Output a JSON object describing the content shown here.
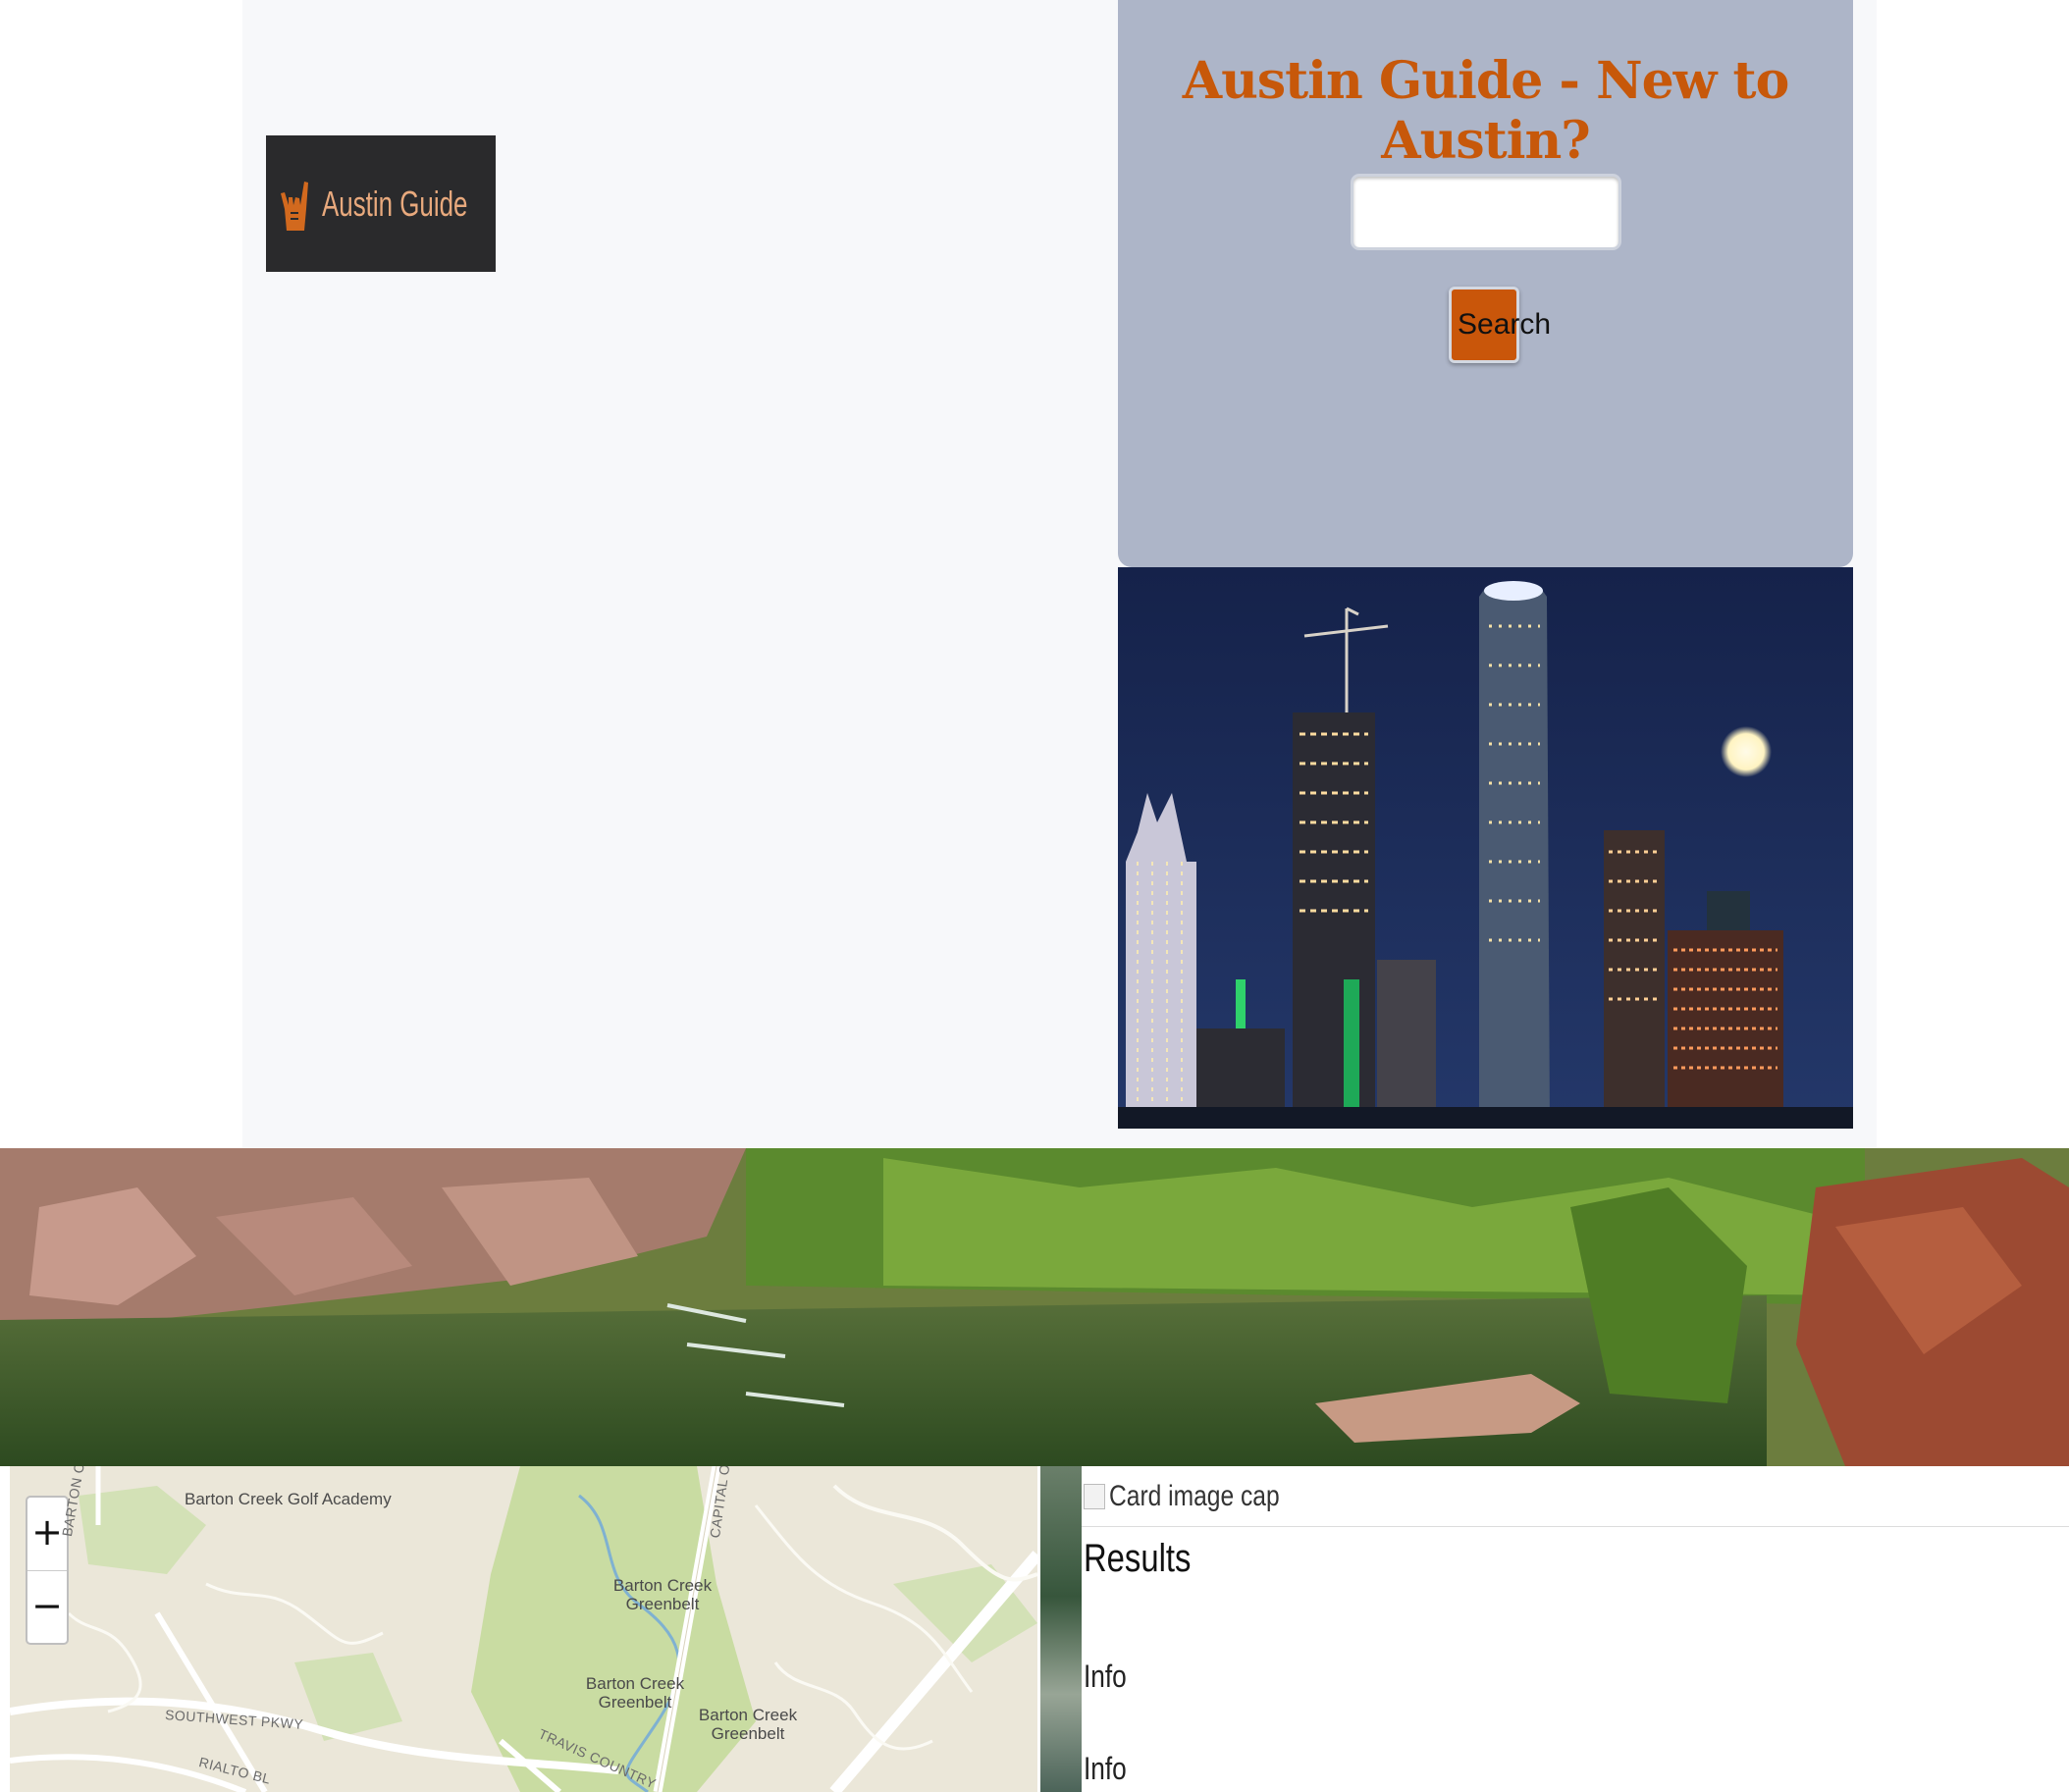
{
  "brand": {
    "name": "Austin Guide",
    "icon": "rock-hand-icon"
  },
  "search_card": {
    "title": "Austin Guide - New to Austin?",
    "input_value": "",
    "input_placeholder": "",
    "button_label": "Search"
  },
  "map": {
    "zoom_in_label": "+",
    "zoom_out_label": "−",
    "places": [
      "Barton Creek Golf Academy",
      "Barton Creek Greenbelt",
      "Barton Creek Greenbelt",
      "Barton Creek Greenbelt"
    ],
    "roads": [
      "BARTON CR",
      "CAPITAL OF",
      "SOUTHWEST PKWY",
      "RIALTO BL",
      "TRAVIS COUNTRY"
    ]
  },
  "results": {
    "image_alt": "Card image cap",
    "heading": "Results",
    "items": [
      "Info",
      "Info"
    ]
  },
  "colors": {
    "accent": "#c7580a",
    "card_bg": "#adb5c8",
    "brand_bg": "#2a2a2c"
  }
}
